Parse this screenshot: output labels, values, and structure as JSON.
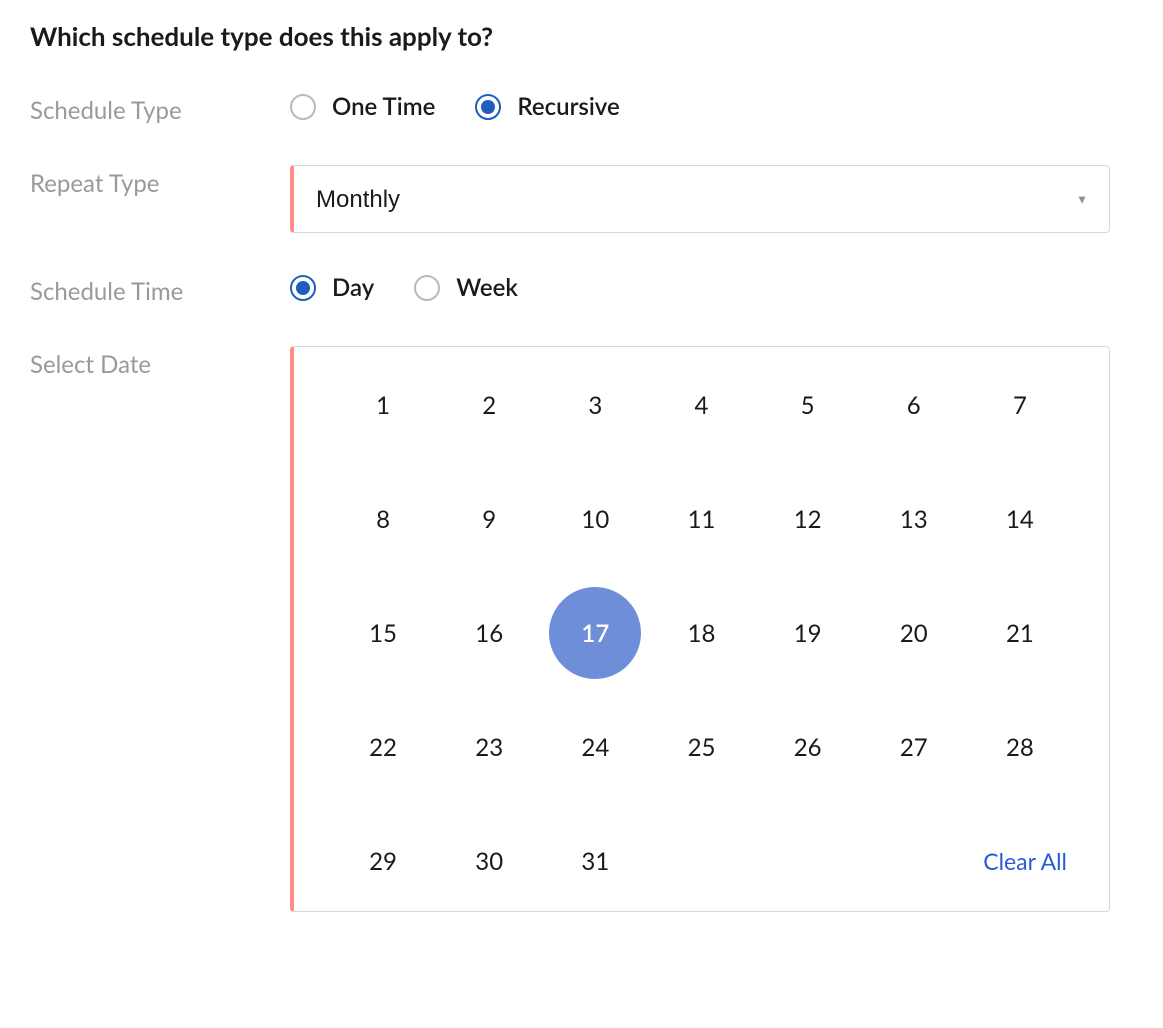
{
  "heading": "Which schedule type does this apply to?",
  "labels": {
    "scheduleType": "Schedule Type",
    "repeatType": "Repeat Type",
    "scheduleTime": "Schedule Time",
    "selectDate": "Select Date"
  },
  "scheduleTypeOptions": {
    "oneTime": "One Time",
    "recursive": "Recursive"
  },
  "scheduleTypeSelected": "recursive",
  "repeatType": {
    "value": "Monthly"
  },
  "scheduleTimeOptions": {
    "day": "Day",
    "week": "Week"
  },
  "scheduleTimeSelected": "day",
  "calendar": {
    "days": [
      "1",
      "2",
      "3",
      "4",
      "5",
      "6",
      "7",
      "8",
      "9",
      "10",
      "11",
      "12",
      "13",
      "14",
      "15",
      "16",
      "17",
      "18",
      "19",
      "20",
      "21",
      "22",
      "23",
      "24",
      "25",
      "26",
      "27",
      "28",
      "29",
      "30",
      "31"
    ],
    "selectedDay": "17",
    "clearAll": "Clear All"
  }
}
